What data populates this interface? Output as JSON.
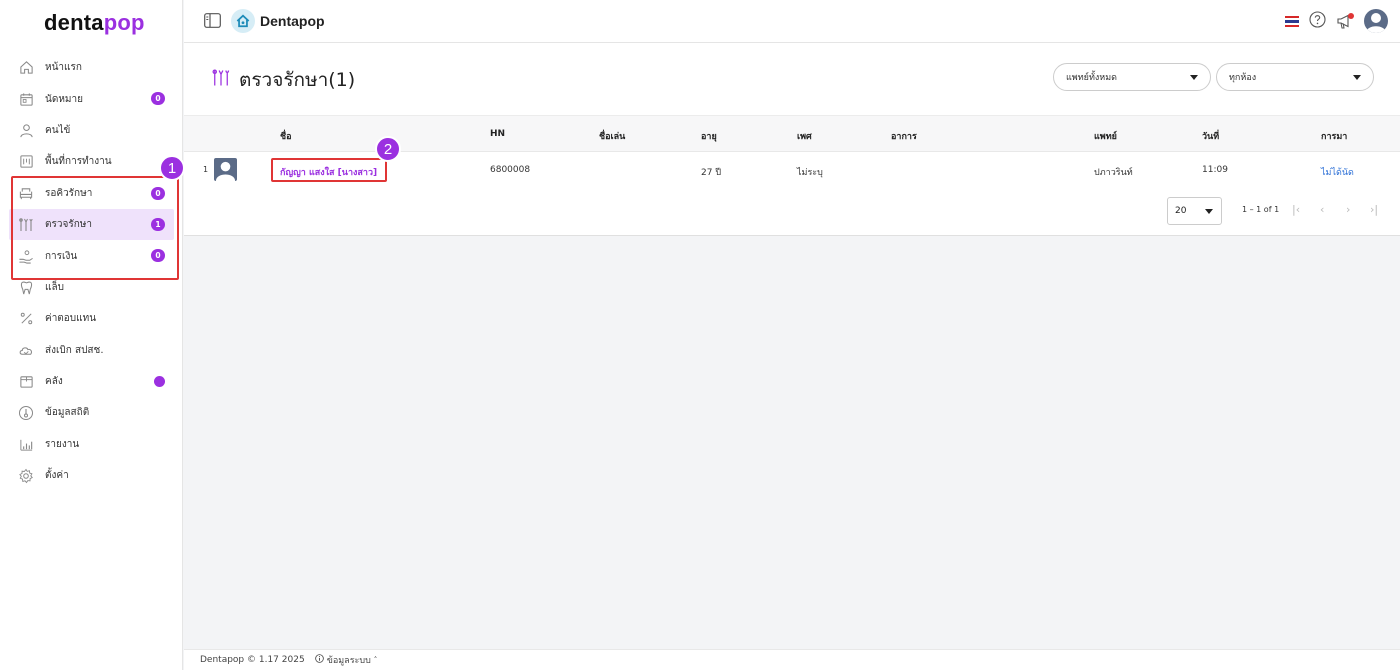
{
  "logo": {
    "main": "denta",
    "accent": "pop"
  },
  "sidebar": {
    "items": [
      {
        "label": "หน้าแรก",
        "icon": "home-icon"
      },
      {
        "label": "นัดหมาย",
        "icon": "calendar-icon",
        "badge": "0"
      },
      {
        "label": "คนไข้",
        "icon": "user-icon"
      },
      {
        "label": "พื้นที่การทำงาน",
        "icon": "workspace-icon"
      },
      {
        "label": "รอคิวรักษา",
        "icon": "dental-chair-icon",
        "badge": "0"
      },
      {
        "label": "ตรวจรักษา",
        "icon": "dental-tools-icon",
        "badge": "1"
      },
      {
        "label": "การเงิน",
        "icon": "hand-coin-icon",
        "badge": "0"
      },
      {
        "label": "แล็บ",
        "icon": "tooth-icon"
      },
      {
        "label": "ค่าตอบแทน",
        "icon": "percent-icon"
      },
      {
        "label": "ส่งเบิก สปสช.",
        "icon": "cloud-icon"
      },
      {
        "label": "คลัง",
        "icon": "box-icon"
      },
      {
        "label": "ข้อมูลสถิติ",
        "icon": "thermometer-icon"
      },
      {
        "label": "รายงาน",
        "icon": "bar-chart-icon"
      },
      {
        "label": "ตั้งค่า",
        "icon": "gear-icon"
      }
    ]
  },
  "topbar": {
    "brand": "Dentapop"
  },
  "page": {
    "title": "ตรวจรักษา(1)",
    "doctor_filter": "แพทย์ทั้งหมด",
    "room_filter": "ทุกห้อง"
  },
  "table": {
    "headers": {
      "name": "ชื่อ",
      "hn": "HN",
      "nickname": "ชื่อเล่น",
      "age": "อายุ",
      "sex": "เพศ",
      "symptom": "อาการ",
      "doctor": "แพทย์",
      "date": "วันที่",
      "visit": "การมา"
    },
    "rows": [
      {
        "index": "1",
        "name": "กัญญา แสงใส [นางสาว]",
        "hn": "6800008",
        "nickname": "",
        "age": "27 ปี",
        "sex": "ไม่ระบุ",
        "symptom": "",
        "doctor": "ปภาวรินท์",
        "date": "11:09",
        "visit": "ไม่ได้นัด"
      }
    ]
  },
  "pagination": {
    "page_size": "20",
    "range": "1 – 1 of 1"
  },
  "annotations": {
    "first": "1",
    "second": "2"
  },
  "footer": {
    "copyright": "Dentapop © 1.17 2025",
    "system_info": "ข้อมูลระบบ"
  },
  "colors": {
    "accent": "#9b30e0",
    "highlight": "#e03535",
    "link": "#2c6fd6"
  }
}
